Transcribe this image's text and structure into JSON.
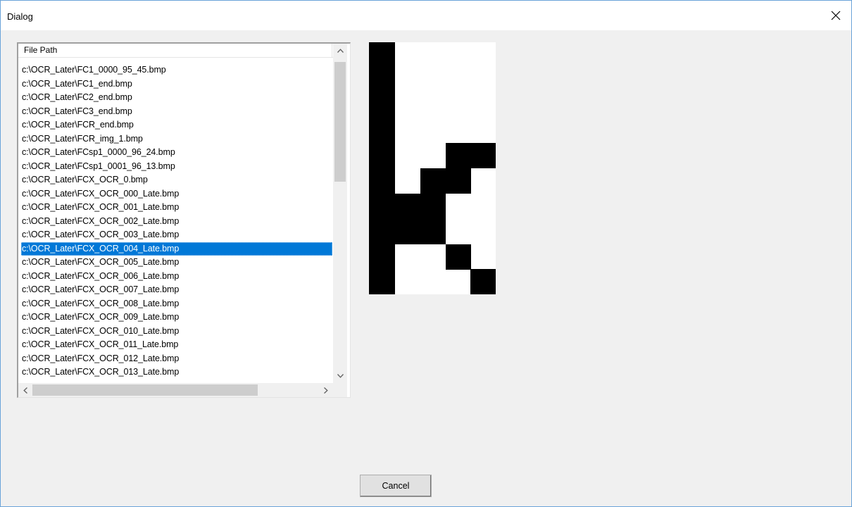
{
  "window": {
    "title": "Dialog",
    "close_icon": "close-icon"
  },
  "list": {
    "column_header": "File Path",
    "selected_index": 14,
    "rows": [
      "c:\\OCR_Later\\FC1_0000_95_45.bmp",
      "c:\\OCR_Later\\FC1_end.bmp",
      "c:\\OCR_Later\\FC2_end.bmp",
      "c:\\OCR_Later\\FC3_end.bmp",
      "c:\\OCR_Later\\FCR_end.bmp",
      "c:\\OCR_Later\\FCR_img_1.bmp",
      "c:\\OCR_Later\\FCsp1_0000_96_24.bmp",
      "c:\\OCR_Later\\FCsp1_0001_96_13.bmp",
      "c:\\OCR_Later\\FCX_OCR_0.bmp",
      "c:\\OCR_Later\\FCX_OCR_000_Late.bmp",
      "c:\\OCR_Later\\FCX_OCR_001_Late.bmp",
      "c:\\OCR_Later\\FCX_OCR_002_Late.bmp",
      "c:\\OCR_Later\\FCX_OCR_003_Late.bmp",
      "c:\\OCR_Later\\FCX_OCR_004_Late.bmp",
      "c:\\OCR_Later\\FCX_OCR_005_Late.bmp",
      "c:\\OCR_Later\\FCX_OCR_006_Late.bmp",
      "c:\\OCR_Later\\FCX_OCR_007_Late.bmp",
      "c:\\OCR_Later\\FCX_OCR_008_Late.bmp",
      "c:\\OCR_Later\\FCX_OCR_009_Late.bmp",
      "c:\\OCR_Later\\FCX_OCR_010_Late.bmp",
      "c:\\OCR_Later\\FCX_OCR_011_Late.bmp",
      "c:\\OCR_Later\\FCX_OCR_012_Late.bmp",
      "c:\\OCR_Later\\FCX_OCR_013_Late.bmp"
    ],
    "scroll_up_icon": "chevron-up-icon",
    "scroll_down_icon": "chevron-down-icon",
    "scroll_left_icon": "chevron-left-icon",
    "scroll_right_icon": "chevron-right-icon"
  },
  "preview": {
    "description_icon": "glyph-bitmap-preview"
  },
  "buttons": {
    "cancel_label": "Cancel"
  },
  "colors": {
    "selection": "#0078d7",
    "window_border": "#6aa3d9",
    "dialog_background": "#f0f0f0"
  }
}
